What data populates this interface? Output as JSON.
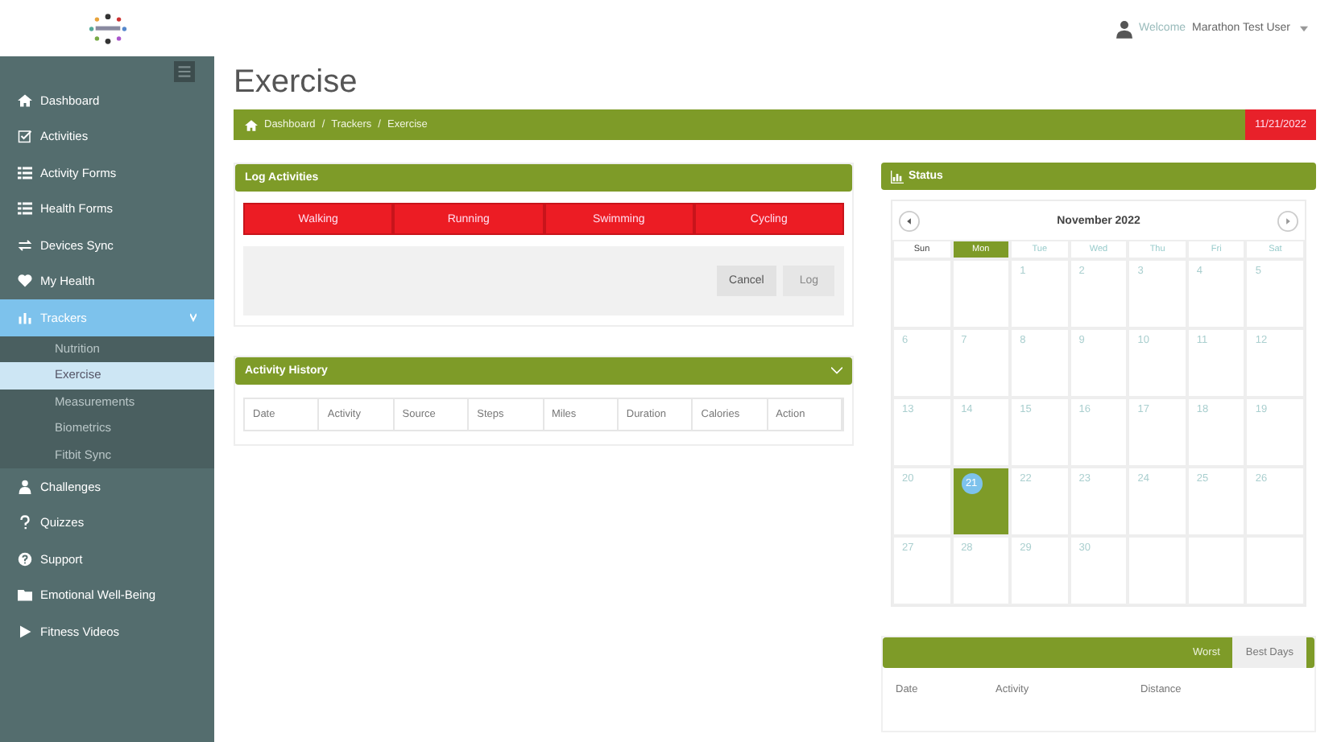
{
  "header": {
    "welcome": "Welcome",
    "user": "Marathon Test User"
  },
  "sidebar": {
    "items": [
      {
        "label": "Dashboard",
        "selected": false
      },
      {
        "label": "Activities",
        "selected": false
      },
      {
        "label": "Activity Forms",
        "selected": false
      },
      {
        "label": "Health Forms",
        "selected": false
      },
      {
        "label": "Devices Sync",
        "selected": false
      },
      {
        "label": "My Health",
        "selected": false
      },
      {
        "label": "Trackers",
        "selected": true,
        "expanded": true,
        "children": [
          {
            "label": "Nutrition",
            "selected": false
          },
          {
            "label": "Exercise",
            "selected": true
          },
          {
            "label": "Measurements",
            "selected": false
          },
          {
            "label": "Biometrics",
            "selected": false
          },
          {
            "label": "Fitbit Sync",
            "selected": false
          }
        ]
      },
      {
        "label": "Challenges",
        "selected": false
      },
      {
        "label": "Quizzes",
        "selected": false
      },
      {
        "label": "Support",
        "selected": false
      },
      {
        "label": "Emotional Well-Being",
        "selected": false
      },
      {
        "label": "Fitness Videos",
        "selected": false
      }
    ]
  },
  "page_title": "Exercise",
  "breadcrumb": {
    "items": [
      "Dashboard",
      "Trackers",
      "Exercise"
    ],
    "separators": [
      "/",
      "/"
    ]
  },
  "date": "11/21/2022",
  "log_activities": {
    "title": "Log Activities",
    "activities": [
      "Walking",
      "Running",
      "Swimming",
      "Cycling"
    ],
    "buttons": [
      {
        "label": "Cancel",
        "disabled": false
      },
      {
        "label": "Log",
        "disabled": true
      }
    ]
  },
  "activity_history": {
    "title": "Activity History",
    "columns": [
      "Date",
      "Activity",
      "Source",
      "Steps",
      "Miles",
      "Duration",
      "Calories",
      "Action"
    ]
  },
  "status": {
    "title": "Status",
    "month": "November 2022",
    "weekdays": [
      {
        "label": "Sun",
        "selected": false
      },
      {
        "label": "Mon",
        "selected": true
      },
      {
        "label": "Tue",
        "selected": false
      },
      {
        "label": "Wed",
        "selected": false
      },
      {
        "label": "Thu",
        "selected": false
      },
      {
        "label": "Fri",
        "selected": false
      },
      {
        "label": "Sat",
        "selected": false
      }
    ],
    "weeks": [
      [
        {
          "day": "1",
          "selected": false
        },
        {
          "day": "2",
          "selected": false
        },
        {
          "day": "3",
          "selected": false
        },
        {
          "day": "4",
          "selected": false
        },
        {
          "day": "5",
          "selected": false
        }
      ],
      [
        {
          "day": "6",
          "selected": false
        },
        {
          "day": "7",
          "selected": false
        },
        {
          "day": "8",
          "selected": false
        },
        {
          "day": "9",
          "selected": false
        },
        {
          "day": "10",
          "selected": false
        },
        {
          "day": "11",
          "selected": false
        },
        {
          "day": "12",
          "selected": false
        }
      ],
      [
        {
          "day": "13",
          "selected": false
        },
        {
          "day": "14",
          "selected": false
        },
        {
          "day": "15",
          "selected": false
        },
        {
          "day": "16",
          "selected": false
        },
        {
          "day": "17",
          "selected": false
        },
        {
          "day": "18",
          "selected": false
        },
        {
          "day": "19",
          "selected": false
        }
      ],
      [
        {
          "day": "20",
          "selected": false
        },
        {
          "day": "21",
          "selected": true
        },
        {
          "day": "22",
          "selected": false
        },
        {
          "day": "23",
          "selected": false
        },
        {
          "day": "24",
          "selected": false
        },
        {
          "day": "25",
          "selected": false
        },
        {
          "day": "26",
          "selected": false
        }
      ],
      [
        {
          "day": "27",
          "selected": false
        },
        {
          "day": "28",
          "selected": false
        },
        {
          "day": "29",
          "selected": false
        },
        {
          "day": "30",
          "selected": false
        }
      ]
    ]
  },
  "days_panel": {
    "tabs": [
      {
        "label": "Worst",
        "selected": true
      },
      {
        "label": "Best Days",
        "selected": false
      }
    ],
    "columns": [
      "Date",
      "Activity",
      "Distance"
    ]
  }
}
